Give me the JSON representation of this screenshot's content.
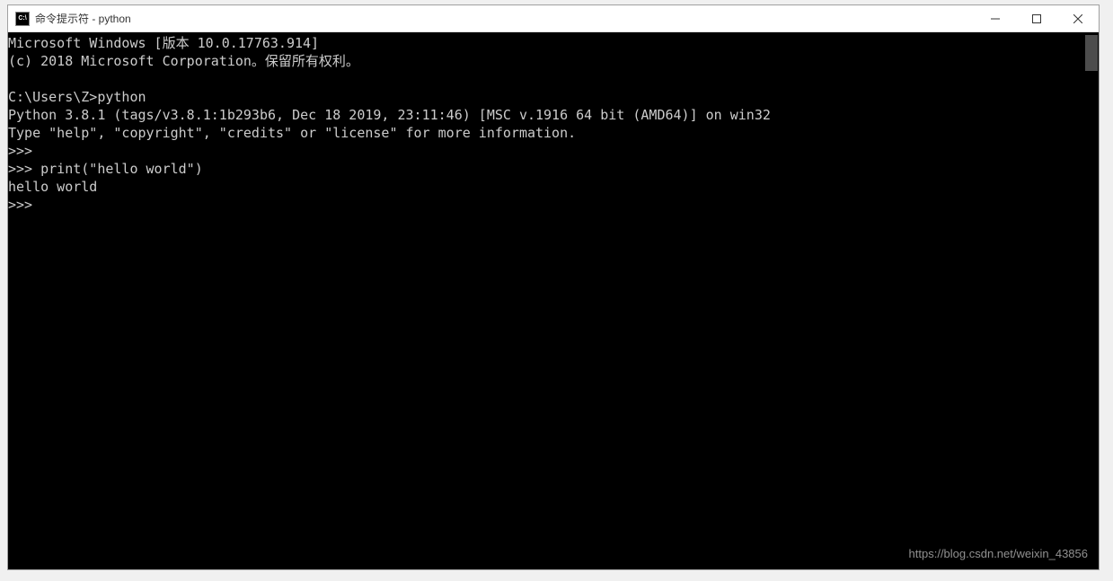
{
  "window": {
    "title": "命令提示符 - python",
    "icon_text": "C:\\"
  },
  "terminal": {
    "lines": [
      "Microsoft Windows [版本 10.0.17763.914]",
      "(c) 2018 Microsoft Corporation。保留所有权利。",
      "",
      "C:\\Users\\Z>python",
      "Python 3.8.1 (tags/v3.8.1:1b293b6, Dec 18 2019, 23:11:46) [MSC v.1916 64 bit (AMD64)] on win32",
      "Type \"help\", \"copyright\", \"credits\" or \"license\" for more information.",
      ">>>",
      ">>> print(\"hello world\")",
      "hello world",
      ">>>"
    ]
  },
  "watermark": "https://blog.csdn.net/weixin_43856"
}
